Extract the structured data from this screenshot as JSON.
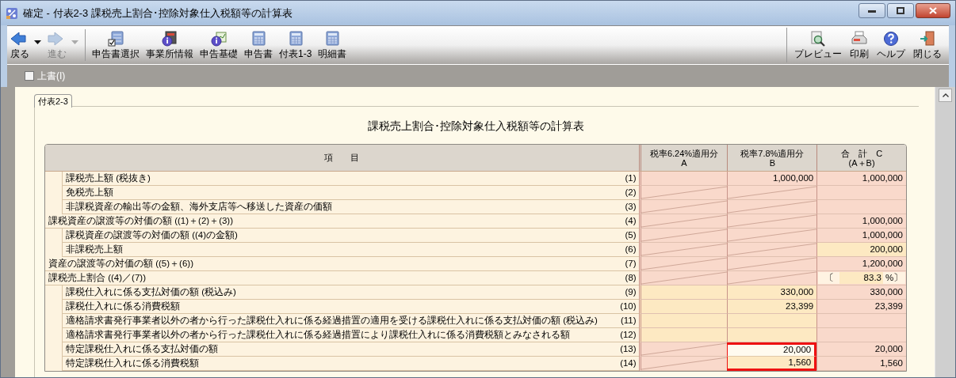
{
  "window": {
    "title": "確定 - 付表2-3 課税売上割合･控除対象仕入税額等の計算表"
  },
  "toolbar": {
    "left": [
      {
        "label": "戻る",
        "disabled": false,
        "dropdown": true
      },
      {
        "label": "進む",
        "disabled": true,
        "dropdown": true
      },
      {
        "label": "申告書選択",
        "disabled": false,
        "dropdown": false
      },
      {
        "label": "事業所情報",
        "disabled": false,
        "dropdown": false
      },
      {
        "label": "申告基礎",
        "disabled": false,
        "dropdown": false
      },
      {
        "label": "申告書",
        "disabled": false,
        "dropdown": false
      },
      {
        "label": "付表1-3",
        "disabled": false,
        "dropdown": false
      },
      {
        "label": "明細書",
        "disabled": false,
        "dropdown": false
      }
    ],
    "right": [
      {
        "label": "プレビュー"
      },
      {
        "label": "印刷"
      },
      {
        "label": "ヘルプ"
      },
      {
        "label": "閉じる"
      }
    ]
  },
  "overwrite": {
    "label": "上書(I)",
    "checked": false
  },
  "tabs": [
    {
      "label": "付表2-3",
      "selected": true
    }
  ],
  "form_title": "課税売上割合･控除対象仕入税額等の計算表",
  "table": {
    "item_header": "項　　目",
    "columns": [
      {
        "lines": [
          "税率6.24%適用分",
          "A"
        ]
      },
      {
        "lines": [
          "税率7.8%適用分",
          "B"
        ]
      },
      {
        "lines": [
          "合　計　C",
          "(A＋B)"
        ]
      }
    ],
    "rows": [
      {
        "label": "課税売上額 (税抜き)",
        "no": "(1)",
        "indented": true,
        "cells": [
          {
            "kind": "calc"
          },
          {
            "kind": "calc",
            "value": "1,000,000"
          },
          {
            "kind": "calc",
            "value": "1,000,000"
          }
        ]
      },
      {
        "label": "免税売上額",
        "no": "(2)",
        "indented": true,
        "cells": [
          {
            "kind": "slashed"
          },
          {
            "kind": "slashed"
          },
          {
            "kind": "calc"
          }
        ]
      },
      {
        "label": "非課税資産の輸出等の金額、海外支店等へ移送した資産の価額",
        "no": "(3)",
        "indented": true,
        "cells": [
          {
            "kind": "slashed"
          },
          {
            "kind": "slashed"
          },
          {
            "kind": "calc"
          }
        ]
      },
      {
        "label": "課税資産の譲渡等の対価の額 ((1)＋(2)＋(3))",
        "no": "(4)",
        "indented": false,
        "cells": [
          {
            "kind": "slashed"
          },
          {
            "kind": "slashed"
          },
          {
            "kind": "calc",
            "value": "1,000,000"
          }
        ]
      },
      {
        "label": "課税資産の譲渡等の対価の額 ((4)の金額)",
        "no": "(5)",
        "indented": true,
        "cells": [
          {
            "kind": "slashed"
          },
          {
            "kind": "slashed"
          },
          {
            "kind": "calc",
            "value": "1,000,000"
          }
        ]
      },
      {
        "label": "非課税売上額",
        "no": "(6)",
        "indented": true,
        "cells": [
          {
            "kind": "slashed"
          },
          {
            "kind": "slashed"
          },
          {
            "kind": "input",
            "value": "200,000"
          }
        ]
      },
      {
        "label": "資産の譲渡等の対価の額 ((5)＋(6))",
        "no": "(7)",
        "indented": false,
        "cells": [
          {
            "kind": "slashed"
          },
          {
            "kind": "slashed"
          },
          {
            "kind": "calc",
            "value": "1,200,000"
          }
        ]
      },
      {
        "label": "課税売上割合 ((4)／(7))",
        "no": "(8)",
        "indented": false,
        "cells": [
          {
            "kind": "slashed"
          },
          {
            "kind": "slashed"
          },
          {
            "kind": "ratio",
            "open": "〔",
            "value": "83.3",
            "close": "%〕"
          }
        ]
      },
      {
        "label": "課税仕入れに係る支払対価の額 (税込み)",
        "no": "(9)",
        "indented": true,
        "cells": [
          {
            "kind": "input"
          },
          {
            "kind": "input",
            "value": "330,000"
          },
          {
            "kind": "calc",
            "value": "330,000"
          }
        ]
      },
      {
        "label": "課税仕入れに係る消費税額",
        "no": "(10)",
        "indented": true,
        "cells": [
          {
            "kind": "input"
          },
          {
            "kind": "input",
            "value": "23,399"
          },
          {
            "kind": "calc",
            "value": "23,399"
          }
        ]
      },
      {
        "label": "適格請求書発行事業者以外の者から行った課税仕入れに係る経過措置の適用を受ける課税仕入れに係る支払対価の額 (税込み)",
        "no": "(11)",
        "indented": true,
        "cells": [
          {
            "kind": "input"
          },
          {
            "kind": "input"
          },
          {
            "kind": "calc"
          }
        ]
      },
      {
        "label": "適格請求書発行事業者以外の者から行った課税仕入れに係る経過措置により課税仕入れに係る消費税額とみなされる額",
        "no": "(12)",
        "indented": true,
        "cells": [
          {
            "kind": "input"
          },
          {
            "kind": "input"
          },
          {
            "kind": "calc"
          }
        ]
      },
      {
        "label": "特定課税仕入れに係る支払対価の額",
        "no": "(13)",
        "indented": true,
        "cells": [
          {
            "kind": "slashed"
          },
          {
            "kind": "input",
            "value": "20,000",
            "focused": true,
            "outlined": true
          },
          {
            "kind": "calc",
            "value": "20,000"
          }
        ]
      },
      {
        "label": "特定課税仕入れに係る消費税額",
        "no": "(14)",
        "indented": true,
        "cells": [
          {
            "kind": "slashed"
          },
          {
            "kind": "input",
            "value": "1,560",
            "outlined": true
          },
          {
            "kind": "calc",
            "value": "1,560"
          }
        ]
      }
    ]
  }
}
